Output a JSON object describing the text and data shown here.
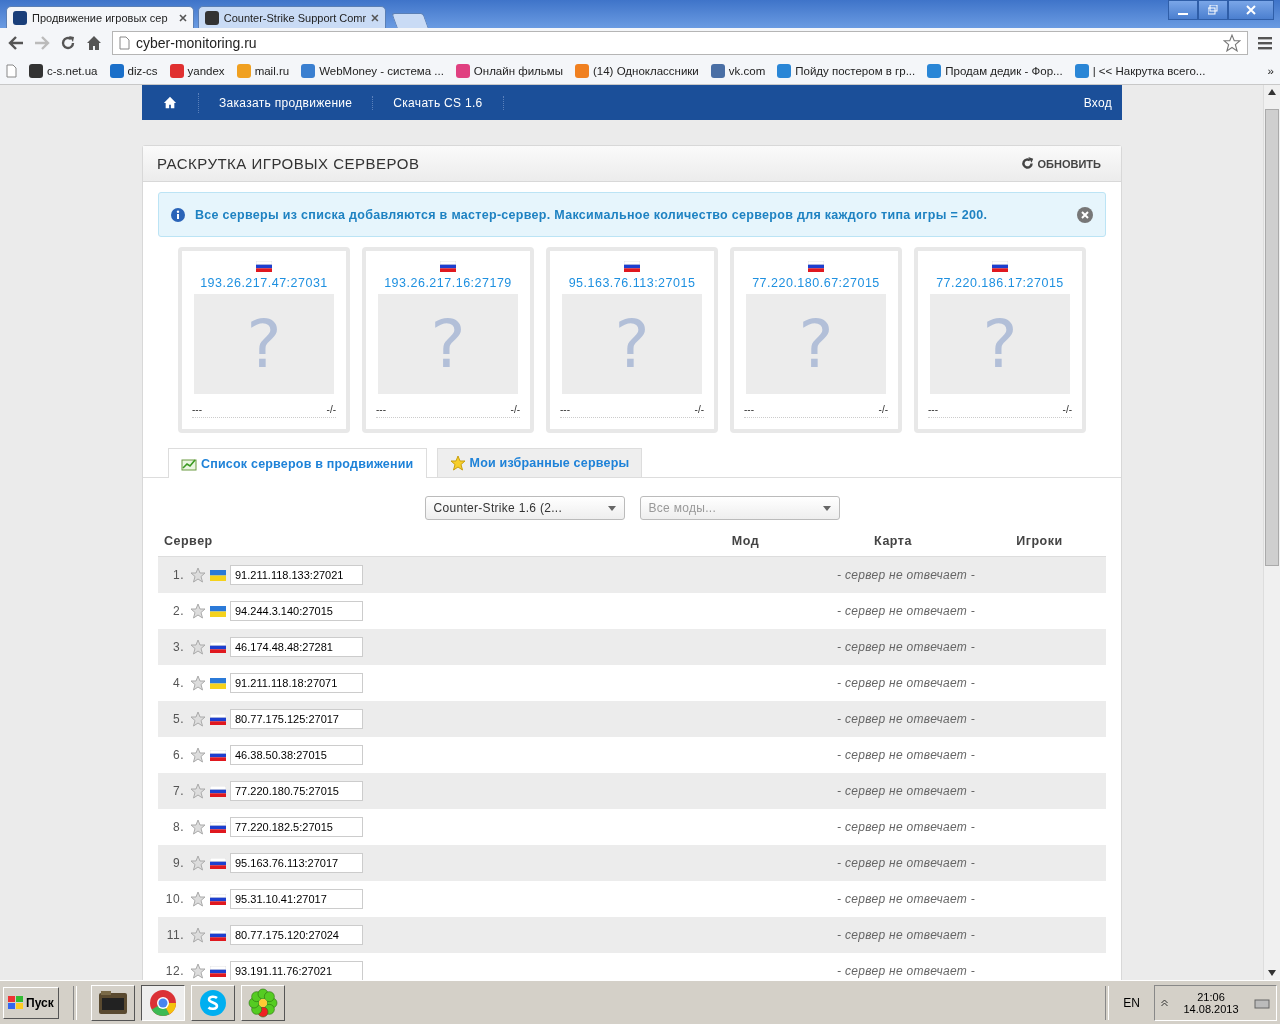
{
  "browser": {
    "tabs": [
      {
        "title": "Продвижение игровых сер",
        "selected": true
      },
      {
        "title": "Counter-Strike Support Comr",
        "selected": false
      }
    ],
    "address": "cyber-monitoring.ru",
    "bookmarks": [
      "c-s.net.ua",
      "diz-cs",
      "yandex",
      "mail.ru",
      "WebMoney - система ...",
      "Онлайн фильмы",
      "(14) Одноклассники",
      "vk.com",
      "Пойду постером в гр...",
      "Продам дедик - Фор...",
      "| << Накрутка всего..."
    ],
    "more": "»"
  },
  "site_nav": {
    "items": [
      "Заказать продвижение",
      "Скачать CS 1.6"
    ],
    "login": "Вход"
  },
  "panel": {
    "title": "РАСКРУТКА ИГРОВЫХ СЕРВЕРОВ",
    "refresh": "ОБНОВИТЬ",
    "alert": "Все серверы из списка добавляются в мастер-сервер. Максимальное количество серверов для каждого типа игры = 200.",
    "featured": [
      {
        "kind": "ru",
        "address": "193.26.217.47:27031",
        "mark": "?",
        "name": "---",
        "players": "-/-"
      },
      {
        "kind": "ru",
        "address": "193.26.217.16:27179",
        "mark": "?",
        "name": "---",
        "players": "-/-"
      },
      {
        "kind": "ru",
        "address": "95.163.76.113:27015",
        "mark": "?",
        "name": "---",
        "players": "-/-"
      },
      {
        "kind": "ru",
        "address": "77.220.180.67:27015",
        "mark": "?",
        "name": "---",
        "players": "-/-"
      },
      {
        "kind": "ru",
        "address": "77.220.186.17:27015",
        "mark": "?",
        "name": "---",
        "players": "-/-"
      }
    ],
    "tabs": [
      {
        "label": "Список серверов в продвижении",
        "kind": "chart",
        "selected": true
      },
      {
        "label": "Мои избранные серверы",
        "kind": "star",
        "selected": false
      }
    ],
    "filters": {
      "game": "Counter-Strike 1.6 (2...",
      "mod_placeholder": "Все моды..."
    },
    "table": {
      "columns": [
        "Сервер",
        "Мод",
        "Карта",
        "Игроки"
      ],
      "rows": [
        {
          "num": "1.",
          "kind": "ua",
          "address": "91.211.118.133:27021",
          "status": "- сервер не отвечает -"
        },
        {
          "num": "2.",
          "kind": "ua",
          "address": "94.244.3.140:27015",
          "status": "- сервер не отвечает -"
        },
        {
          "num": "3.",
          "kind": "ru",
          "address": "46.174.48.48:27281",
          "status": "- сервер не отвечает -"
        },
        {
          "num": "4.",
          "kind": "ua",
          "address": "91.211.118.18:27071",
          "status": "- сервер не отвечает -"
        },
        {
          "num": "5.",
          "kind": "ru",
          "address": "80.77.175.125:27017",
          "status": "- сервер не отвечает -"
        },
        {
          "num": "6.",
          "kind": "ru",
          "address": "46.38.50.38:27015",
          "status": "- сервер не отвечает -"
        },
        {
          "num": "7.",
          "kind": "ru",
          "address": "77.220.180.75:27015",
          "status": "- сервер не отвечает -"
        },
        {
          "num": "8.",
          "kind": "ru",
          "address": "77.220.182.5:27015",
          "status": "- сервер не отвечает -"
        },
        {
          "num": "9.",
          "kind": "ru",
          "address": "95.163.76.113:27017",
          "status": "- сервер не отвечает -"
        },
        {
          "num": "10.",
          "kind": "ru",
          "address": "95.31.10.41:27017",
          "status": "- сервер не отвечает -"
        },
        {
          "num": "11.",
          "kind": "ru",
          "address": "80.77.175.120:27024",
          "status": "- сервер не отвечает -"
        },
        {
          "num": "12.",
          "kind": "ru",
          "address": "93.191.11.76:27021",
          "status": "- сервер не отвечает -"
        }
      ]
    }
  },
  "taskbar": {
    "start": "Пуск",
    "apps": [
      {
        "kind": "folder",
        "selected": false
      },
      {
        "kind": "chrome",
        "selected": true
      },
      {
        "kind": "skype",
        "selected": false
      },
      {
        "kind": "flower",
        "selected": false
      }
    ],
    "lang": "EN",
    "time": "21:06",
    "date": "14.08.2013"
  }
}
